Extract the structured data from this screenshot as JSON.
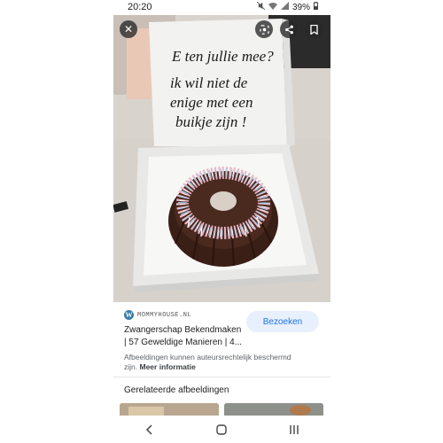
{
  "status_bar": {
    "time": "20:20",
    "battery": "39%",
    "icons": [
      "mute-icon",
      "wifi-icon",
      "signal-icon",
      "battery-icon"
    ]
  },
  "image": {
    "lid_text_lines": [
      "E ten jullie mee?",
      "ik wil niet de",
      "enige met een",
      "buikje zijn !"
    ],
    "buttons": [
      "close-icon",
      "lens-icon",
      "share-icon",
      "bookmark-icon"
    ]
  },
  "result": {
    "source_name": "MOMMYHOUSE.NL",
    "title_line1": "Zwangerschap Bekendmaken",
    "title_line2": "| 57 Geweldige Manieren | 4...",
    "visit_label": "Bezoeken",
    "disclaimer_line1": "Afbeeldingen kunnen auteursrechtelijk beschermd",
    "disclaimer_line2": "zijn.",
    "more_info": "Meer informatie"
  },
  "related": {
    "title": "Gerelateerde afbeeldingen"
  },
  "nav_bar": {
    "back": "‹",
    "home": "○",
    "recents": "|||"
  },
  "colors": {
    "accent": "#1a73e8",
    "button_bg": "#e8f0fe"
  }
}
